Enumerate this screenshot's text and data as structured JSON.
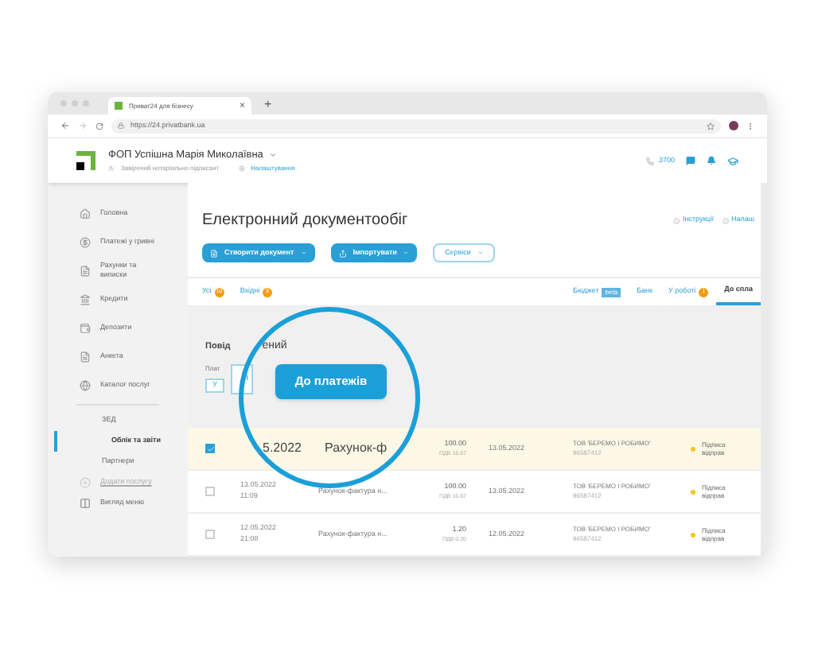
{
  "browser": {
    "tab_title": "Приват24 для бізнесу",
    "tab_close": "×",
    "new_tab": "+",
    "url": "https://24.privatbank.ua"
  },
  "header": {
    "company": "ФОП Успішна Марія Миколаївна",
    "role": "Завірений нотаріально підписант",
    "settings_link": "Налаштування",
    "phone": "3700"
  },
  "sidebar": {
    "items": [
      {
        "label": "Головна"
      },
      {
        "label": "Платежі у гривні"
      },
      {
        "label": "Рахунки та виписки"
      },
      {
        "label": "Кредити"
      },
      {
        "label": "Депозити"
      },
      {
        "label": "Анкета"
      },
      {
        "label": "Каталог послуг"
      }
    ],
    "sub_items": [
      {
        "label": "ЗЕД",
        "selected": false
      },
      {
        "label": "Облік та звіти",
        "selected": true
      },
      {
        "label": "Партнери",
        "selected": false
      }
    ],
    "add_service": "Додати послугу",
    "menu_view": "Вигляд меню"
  },
  "main": {
    "title": "Електронний документообіг",
    "links": [
      "Інструкції",
      "Налаш"
    ],
    "buttons": [
      {
        "kind": "primary",
        "label": "Створити документ"
      },
      {
        "kind": "primary",
        "label": "Імпортувати"
      },
      {
        "kind": "outline",
        "label": "Сервіси"
      }
    ],
    "tabs_left": [
      {
        "label": "Усі",
        "badge": "10",
        "selected": false
      },
      {
        "label": "Вхідні",
        "badge": "8",
        "selected": false
      }
    ],
    "tabs_right": [
      {
        "label": "Бюджет",
        "tag": "beta",
        "selected": false
      },
      {
        "label": "Банк",
        "selected": false
      },
      {
        "label": "У роботі",
        "badge": "1",
        "selected": false
      },
      {
        "label": "До спла",
        "selected": true
      }
    ],
    "panel": {
      "title_left": "Повід",
      "title_right": "ений",
      "field_label": "Плат",
      "field_value": "і",
      "small_button": "У",
      "pay_button": "До платежів"
    },
    "rows": [
      {
        "checked": true,
        "zoomed": true,
        "date": "5.2022",
        "time": "",
        "doc": "Рахунок-ф",
        "amount": "100.00",
        "vat": "ПДВ 16.67",
        "date2": "13.05.2022",
        "org": "ТОВ 'БЕРЕМО І РОБИМО'",
        "code": "96587412",
        "status": "Підписа відправ"
      },
      {
        "checked": false,
        "zoomed": false,
        "date": "13.05.2022",
        "time": "11:09",
        "doc": "Рахунок-фактура н...",
        "amount": "100.00",
        "vat": "ПДВ 16.67",
        "date2": "13.05.2022",
        "org": "ТОВ 'БЕРЕМО І РОБИМО'",
        "code": "96587412",
        "status": "Підписа відправ"
      },
      {
        "checked": false,
        "zoomed": false,
        "date": "12.05.2022",
        "time": "21:08",
        "doc": "Рахунок-фактура н...",
        "amount": "1.20",
        "vat": "ПДВ 0.20",
        "date2": "12.05.2022",
        "org": "ТОВ 'БЕРЕМО І РОБИМО'",
        "code": "96587412",
        "status": "Підписа відправ"
      }
    ]
  }
}
